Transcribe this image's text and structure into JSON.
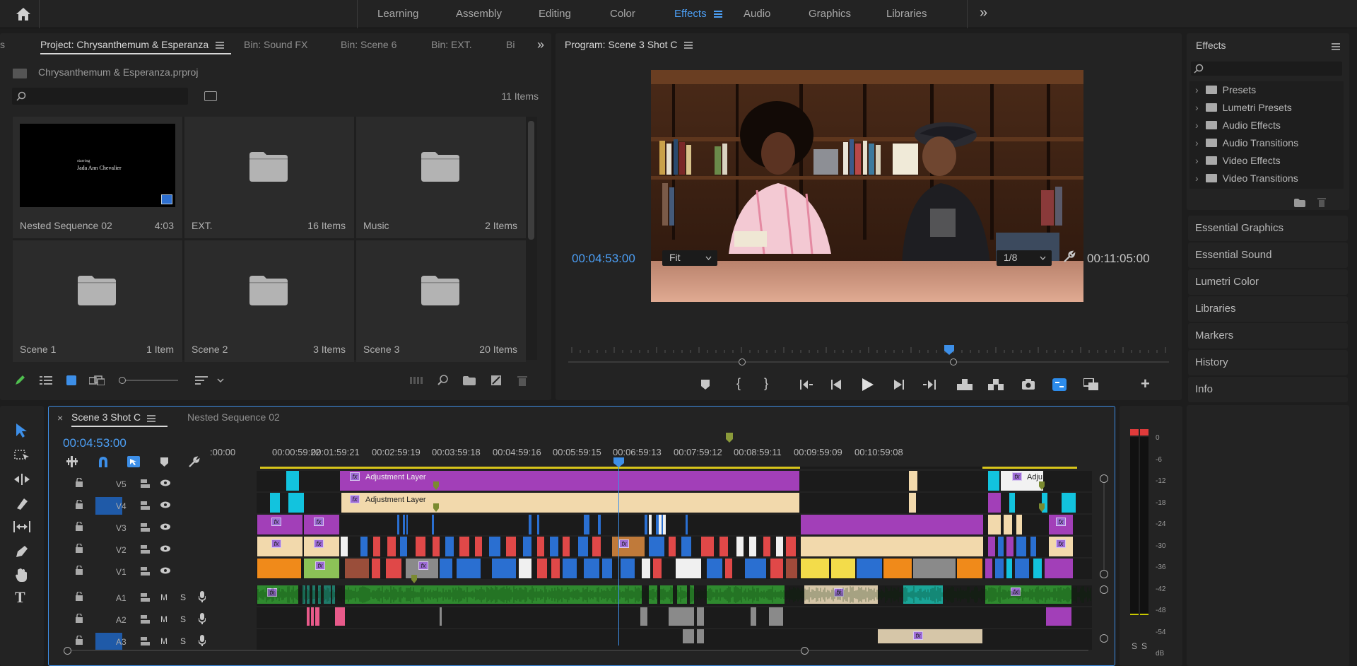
{
  "header": {
    "home_icon": "home-icon",
    "workspaces": [
      "Learning",
      "Assembly",
      "Editing",
      "Color",
      "Effects",
      "Audio",
      "Graphics",
      "Libraries"
    ],
    "active_workspace": "Effects",
    "more": "»"
  },
  "project": {
    "tabs": [
      "Project: Chrysanthemum & Esperanza",
      "Bin: Sound FX",
      "Bin: Scene 6",
      "Bin: EXT.",
      "Bi"
    ],
    "filename": "Chrysanthemum & Esperanza.prproj",
    "search_placeholder": "",
    "item_count": "11 Items",
    "items": [
      {
        "name": "Nested Sequence 02",
        "count": "4:03",
        "type": "sequence",
        "thumb_text_1": "starring",
        "thumb_text_2": "Jada Ann Chevalier"
      },
      {
        "name": "EXT.",
        "count": "16 Items",
        "type": "bin"
      },
      {
        "name": "Music",
        "count": "2 Items",
        "type": "bin"
      },
      {
        "name": "Scene 1",
        "count": "1 Item",
        "type": "bin"
      },
      {
        "name": "Scene 2",
        "count": "3 Items",
        "type": "bin"
      },
      {
        "name": "Scene 3",
        "count": "20 Items",
        "type": "bin"
      }
    ]
  },
  "program": {
    "title": "Program: Scene 3 Shot C",
    "timecode": "00:04:53:00",
    "fit": "Fit",
    "resolution": "1/8",
    "duration": "00:11:05:00"
  },
  "effects": {
    "title": "Effects",
    "items": [
      "Presets",
      "Lumetri Presets",
      "Audio Effects",
      "Audio Transitions",
      "Video Effects",
      "Video Transitions"
    ],
    "panels": [
      "Essential Graphics",
      "Essential Sound",
      "Lumetri Color",
      "Libraries",
      "Markers",
      "History",
      "Info"
    ]
  },
  "timeline": {
    "tabs": [
      "Scene 3 Shot C",
      "Nested Sequence 02"
    ],
    "close": "×",
    "timecode": "00:04:53:00",
    "ruler": [
      ":00:00",
      "00:00:59:22",
      "00:01:59:21",
      "00:02:59:19",
      "00:03:59:18",
      "00:04:59:16",
      "00:05:59:15",
      "00:06:59:13",
      "00:07:59:12",
      "00:08:59:11",
      "00:09:59:09",
      "00:10:59:08"
    ],
    "video_tracks": [
      "V5",
      "V4",
      "V3",
      "V2",
      "V1"
    ],
    "audio_tracks": [
      "A1",
      "A2",
      "A3"
    ],
    "mute": "M",
    "solo": "S",
    "adjustment_label": "Adjustment Layer",
    "adj_short": "Adju",
    "fx": "fx",
    "meter_scale": [
      "0",
      "-6",
      "-12",
      "-18",
      "-24",
      "-30",
      "-36",
      "-42",
      "-48",
      "-54",
      "dB"
    ],
    "meter_solo": [
      "S",
      "S"
    ]
  },
  "colors": {
    "accent": "#2d8ceb",
    "magenta": "#a23fb8",
    "tan": "#f2d9ac",
    "cyan": "#12c3de",
    "orange": "#f08a1a",
    "red": "#e04848",
    "blue": "#2a6fd1",
    "green": "#2f8a2f",
    "yellow": "#f3dc4a"
  }
}
